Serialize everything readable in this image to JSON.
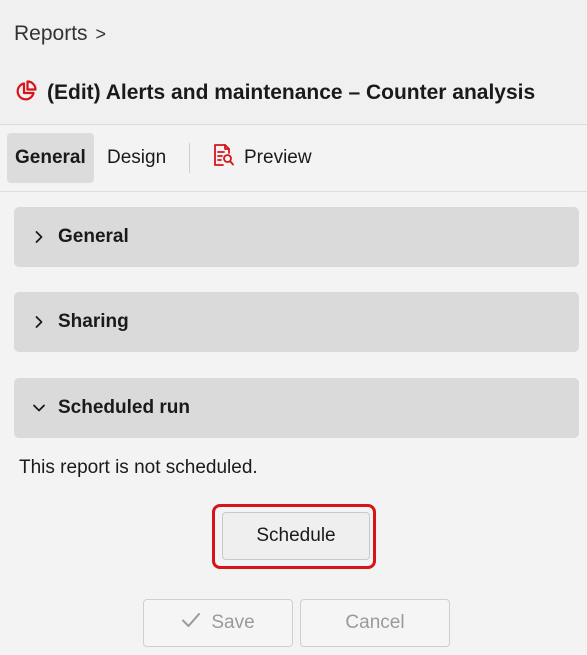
{
  "header": {
    "breadcrumb": {
      "label": "Reports",
      "separator": ">"
    },
    "title": "(Edit) Alerts and maintenance – Counter analysis",
    "title_icon": "pie-chart-icon",
    "accent": "#d7141a"
  },
  "tabs": [
    {
      "label": "General",
      "active": true
    },
    {
      "label": "Design",
      "active": false
    },
    {
      "label": "Preview",
      "active": false,
      "icon": "report-preview-icon"
    }
  ],
  "sections": [
    {
      "label": "General",
      "expanded": false
    },
    {
      "label": "Sharing",
      "expanded": false
    },
    {
      "label": "Scheduled run",
      "expanded": true
    }
  ],
  "scheduled_run": {
    "message": "This report is not scheduled.",
    "schedule_button": "Schedule"
  },
  "footer": {
    "save_label": "Save",
    "save_icon": "checkmark-icon",
    "cancel_label": "Cancel"
  }
}
